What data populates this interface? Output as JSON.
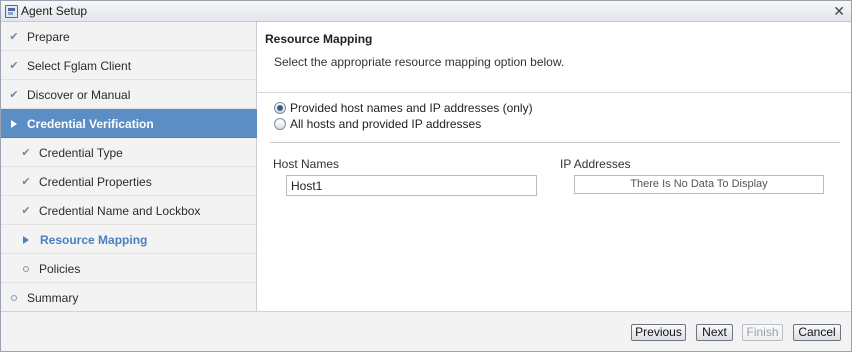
{
  "window": {
    "title": "Agent Setup",
    "icon": "app-icon",
    "close_icon": "close-icon"
  },
  "sidebar": {
    "items": [
      {
        "label": "Prepare",
        "state": "done"
      },
      {
        "label": "Select Fglam Client",
        "state": "done"
      },
      {
        "label": "Discover or Manual",
        "state": "done"
      },
      {
        "label": "Credential Verification",
        "state": "active"
      },
      {
        "label": "Credential Type",
        "state": "done"
      },
      {
        "label": "Credential Properties",
        "state": "done"
      },
      {
        "label": "Credential Name and Lockbox",
        "state": "done"
      },
      {
        "label": "Resource Mapping",
        "state": "current"
      },
      {
        "label": "Policies",
        "state": "pending"
      },
      {
        "label": "Summary",
        "state": "pending"
      }
    ],
    "glyphs": {
      "done": "✔",
      "pending": "○"
    }
  },
  "main": {
    "title": "Resource Mapping",
    "description": "Select the appropriate resource mapping option below.",
    "options": [
      {
        "label": "Provided host names and IP addresses (only)",
        "selected": true
      },
      {
        "label": "All hosts and provided IP addresses",
        "selected": false
      }
    ],
    "host_names": {
      "label": "Host Names",
      "value": "Host1"
    },
    "ip_addresses": {
      "label": "IP Addresses",
      "empty_text": "There Is No Data To Display"
    }
  },
  "footer": {
    "previous_label": "Previous",
    "next_label": "Next",
    "finish_label": "Finish",
    "cancel_label": "Cancel"
  },
  "colors": {
    "active_bg": "#5b8ec4",
    "current_text": "#4a80bf",
    "sidebar_bg": "#f3f3f3"
  }
}
